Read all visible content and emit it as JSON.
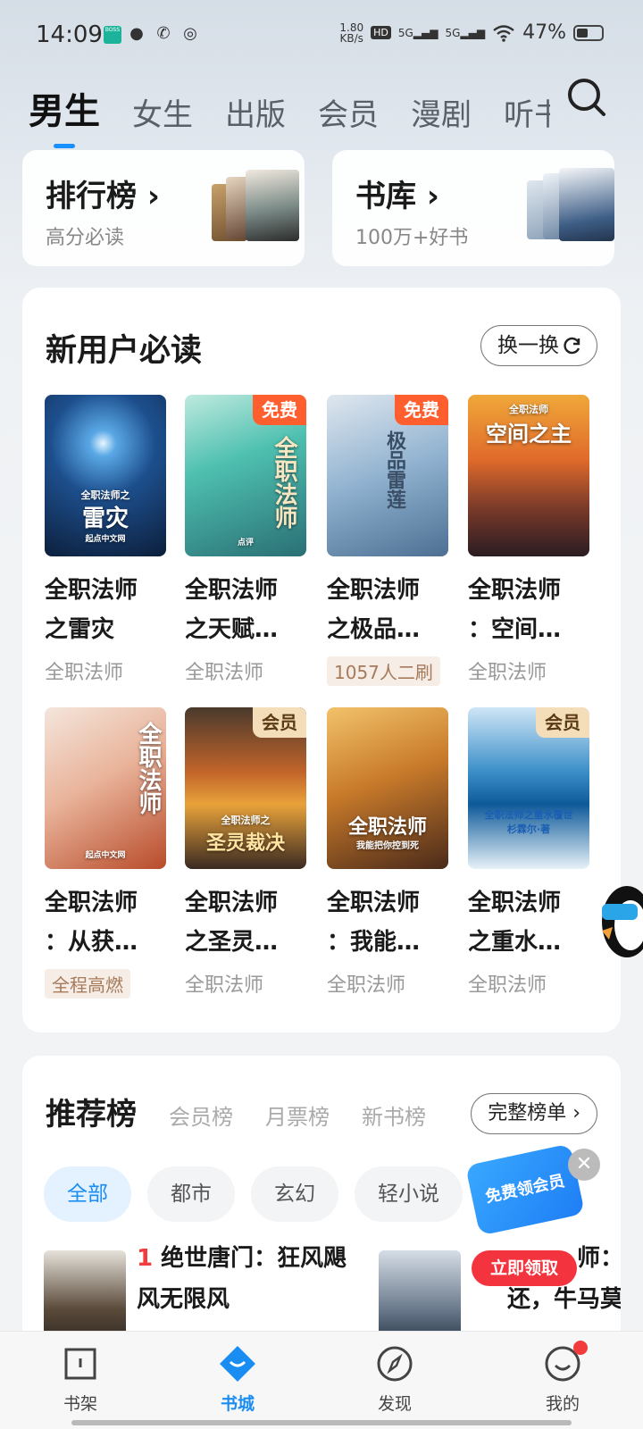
{
  "status_bar": {
    "time": "14:09",
    "net_speed_top": "1.80",
    "net_speed_bottom": "KB/s",
    "hd": "HD",
    "sig1": "5G",
    "sig2": "5G",
    "battery": "47%"
  },
  "tabs": [
    "男生",
    "女生",
    "出版",
    "会员",
    "漫剧",
    "听书"
  ],
  "active_tab": 0,
  "top_cards": [
    {
      "title": "排行榜",
      "subtitle": "高分必读"
    },
    {
      "title": "书库",
      "subtitle": "100万+好书"
    }
  ],
  "new_user": {
    "title": "新用户必读",
    "refresh_label": "换一换",
    "books": [
      {
        "title_line1": "全职法师",
        "title_line2": "之雷灾",
        "sub": "全职法师",
        "cover_text": "雷灾",
        "cover_top": "全职法师之",
        "cover_bottom": "起点中文网"
      },
      {
        "title_line1": "全职法师",
        "title_line2": "之天赋…",
        "sub": "全职法师",
        "badge": "免费",
        "cover_text": "全职法师",
        "cover_bottom": "点评"
      },
      {
        "title_line1": "全职法师",
        "title_line2": "之极品…",
        "tag": "1057人二刷",
        "badge": "免费",
        "cover_text": "极品雷莲"
      },
      {
        "title_line1": "全职法师",
        "title_line2": "：空间…",
        "sub": "全职法师",
        "cover_text": "空间之主",
        "cover_top": "全职法师"
      },
      {
        "title_line1": "全职法师",
        "title_line2": "：从获…",
        "tag": "全程高燃",
        "cover_text": "全职法师",
        "cover_bottom": "起点中文网"
      },
      {
        "title_line1": "全职法师",
        "title_line2": "之圣灵…",
        "sub": "全职法师",
        "badge": "会员",
        "cover_text": "圣灵裁决",
        "cover_top": "全职法师之"
      },
      {
        "title_line1": "全职法师",
        "title_line2": "：我能…",
        "sub": "全职法师",
        "cover_text": "全职法师",
        "cover_bottom": "我能把你控到死"
      },
      {
        "title_line1": "全职法师",
        "title_line2": "之重水…",
        "sub": "全职法师",
        "badge": "会员",
        "cover_text": "全职法师之重水覆世",
        "cover_bottom": "杉霖尔·著"
      }
    ]
  },
  "rank": {
    "tabs": [
      "推荐榜",
      "会员榜",
      "月票榜",
      "新书榜"
    ],
    "full_list_label": "完整榜单",
    "chips": [
      "全部",
      "都市",
      "玄幻",
      "轻小说"
    ],
    "items": [
      {
        "rank": "1",
        "title_line1": "绝世唐门：狂风飓",
        "title_line2": "风无限风"
      },
      {
        "title_line1": "师：",
        "title_line2": "还，牛马莫"
      }
    ]
  },
  "float_widget": {
    "card_text": "免费领会员",
    "button_label": "立即领取"
  },
  "bottom_nav": [
    {
      "label": "书架"
    },
    {
      "label": "书城"
    },
    {
      "label": "发现"
    },
    {
      "label": "我的"
    }
  ]
}
